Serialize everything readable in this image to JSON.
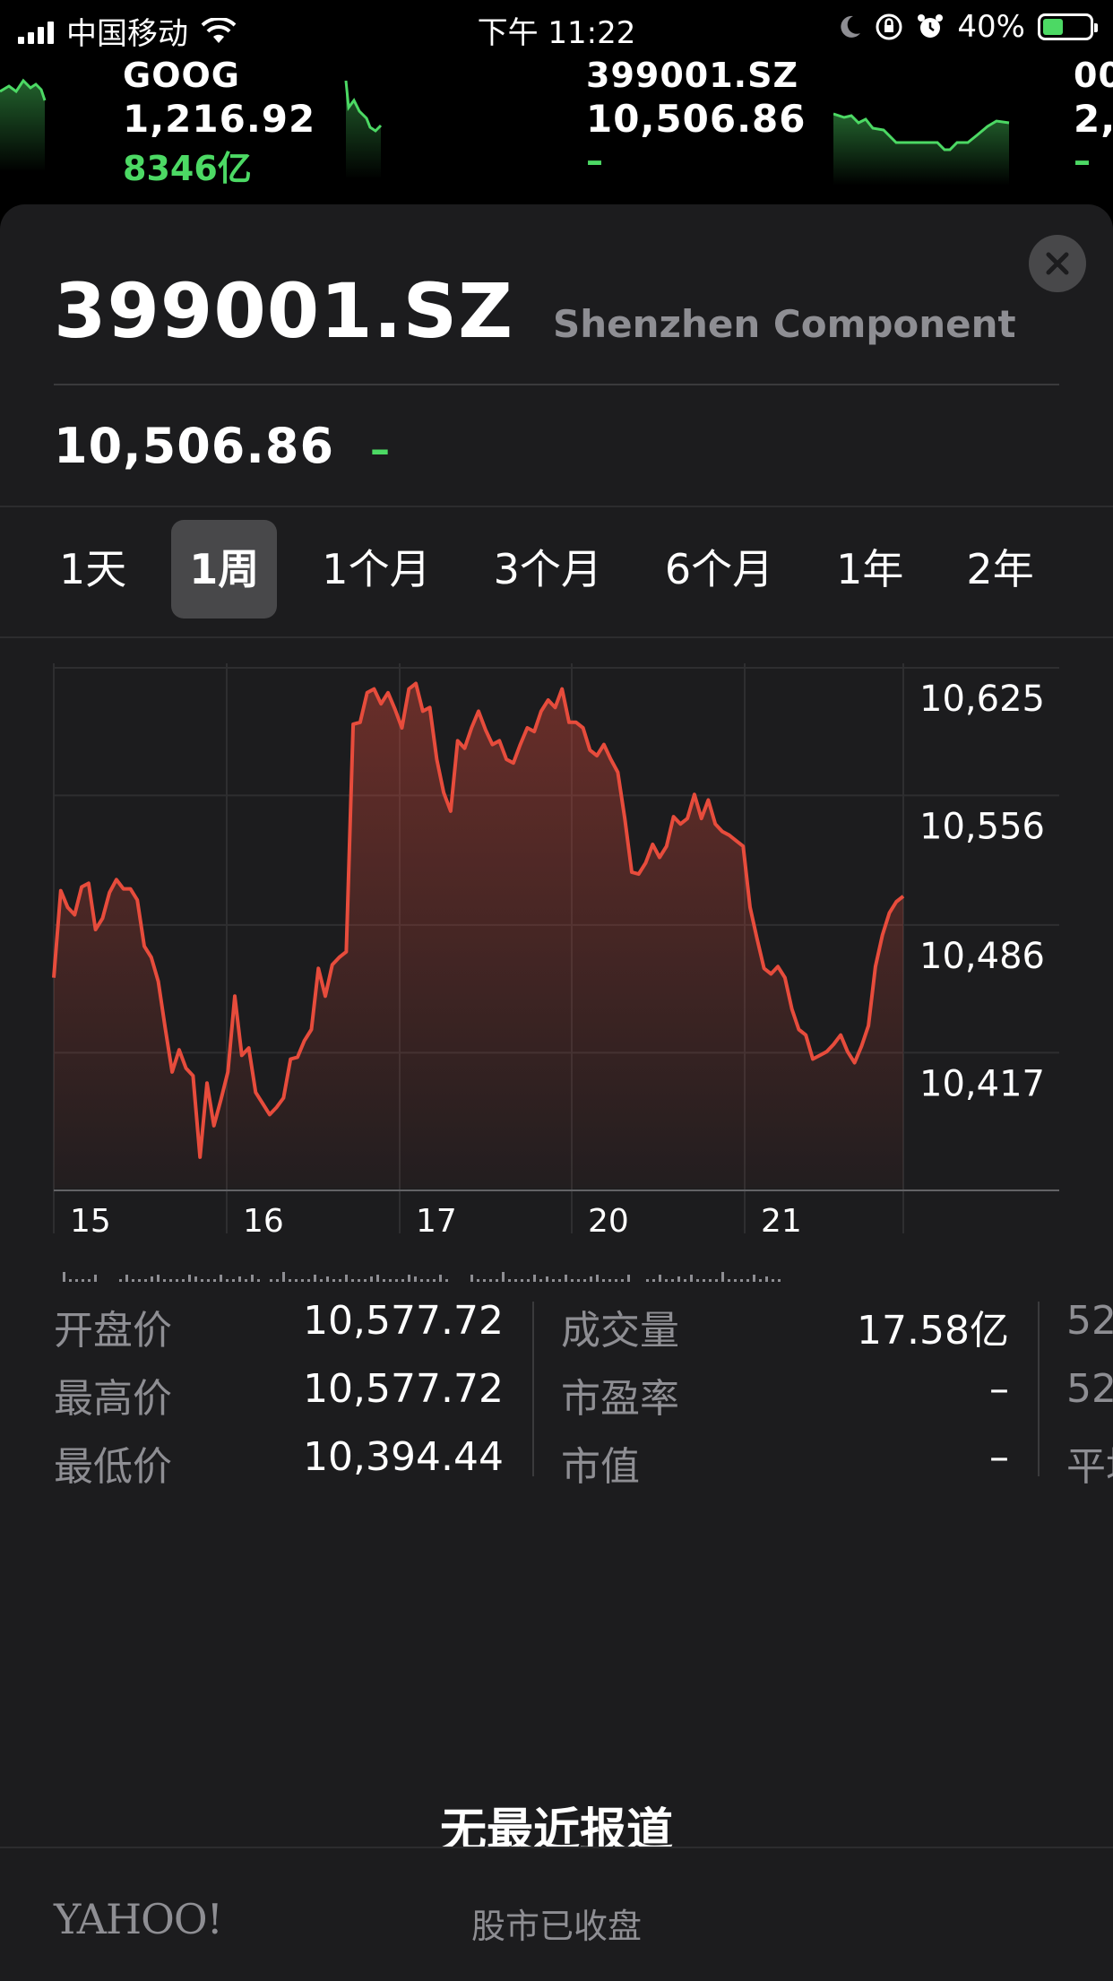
{
  "status_bar": {
    "carrier": "中国移动",
    "time": "下午 11:22",
    "battery": "40%"
  },
  "ticker": [
    {
      "symbol": "GOOG",
      "price": "1,216.92",
      "change": "8346亿"
    },
    {
      "symbol": "399001.SZ",
      "price": "10,506.86",
      "change": "–"
    },
    {
      "symbol": "00",
      "price": "2,",
      "change": "–"
    }
  ],
  "header": {
    "symbol": "399001.SZ",
    "name": "Shenzhen Component",
    "price": "10,506.86",
    "change": "–"
  },
  "ranges": {
    "items": [
      "1天",
      "1周",
      "1个月",
      "3个月",
      "6个月",
      "1年",
      "2年"
    ],
    "active": "1周"
  },
  "chart_data": {
    "type": "area",
    "y_ticks": [
      "10,625",
      "10,556",
      "10,486",
      "10,417"
    ],
    "y_tick_values": [
      10625,
      10556,
      10486,
      10417
    ],
    "ylim": [
      10360,
      10640
    ],
    "x_ticks": [
      "15",
      "16",
      "17",
      "20",
      "21"
    ],
    "line_color": "#e74c3c",
    "grid": true,
    "values": [
      10474,
      10521,
      10512,
      10508,
      10523,
      10525,
      10500,
      10506,
      10520,
      10527,
      10522,
      10522,
      10516,
      10491,
      10485,
      10472,
      10447,
      10423,
      10435,
      10425,
      10421,
      10377,
      10417,
      10394,
      10408,
      10423,
      10464,
      10432,
      10436,
      10412,
      10406,
      10400,
      10404,
      10409,
      10430,
      10431,
      10440,
      10446,
      10479,
      10464,
      10481,
      10485,
      10488,
      10611,
      10612,
      10628,
      10630,
      10622,
      10628,
      10619,
      10609,
      10630,
      10633,
      10618,
      10620,
      10592,
      10574,
      10564,
      10602,
      10598,
      10609,
      10618,
      10608,
      10600,
      10602,
      10592,
      10590,
      10600,
      10609,
      10607,
      10618,
      10624,
      10620,
      10630,
      10612,
      10612,
      10609,
      10597,
      10594,
      10600,
      10592,
      10585,
      10560,
      10531,
      10530,
      10536,
      10546,
      10539,
      10545,
      10561,
      10557,
      10560,
      10573,
      10560,
      10570,
      10557,
      10553,
      10551,
      10548,
      10545,
      10512,
      10495,
      10479,
      10476,
      10480,
      10474,
      10457,
      10446,
      10443,
      10430,
      10432,
      10434,
      10438,
      10443,
      10434,
      10428,
      10437,
      10448,
      10480,
      10497,
      10509,
      10515,
      10518
    ],
    "volume_note": "mini volume bars below x-axis"
  },
  "stats": {
    "col1": [
      {
        "label": "开盘价",
        "value": "10,577.72"
      },
      {
        "label": "最高价",
        "value": "10,577.72"
      },
      {
        "label": "最低价",
        "value": "10,394.44"
      }
    ],
    "col2": [
      {
        "label": "成交量",
        "value": "17.58亿"
      },
      {
        "label": "市盈率",
        "value": "–"
      },
      {
        "label": "市值",
        "value": "–"
      }
    ],
    "col3": [
      {
        "label": "52"
      },
      {
        "label": "52"
      },
      {
        "label": "平均"
      }
    ]
  },
  "news": {
    "empty_text": "无最近报道"
  },
  "footer": {
    "brand": "YAHOO!",
    "market_status": "股市已收盘"
  },
  "colors": {
    "positive": "#4cd964",
    "chart_line": "#e74c3c",
    "sheet_bg": "#1c1c1e"
  }
}
